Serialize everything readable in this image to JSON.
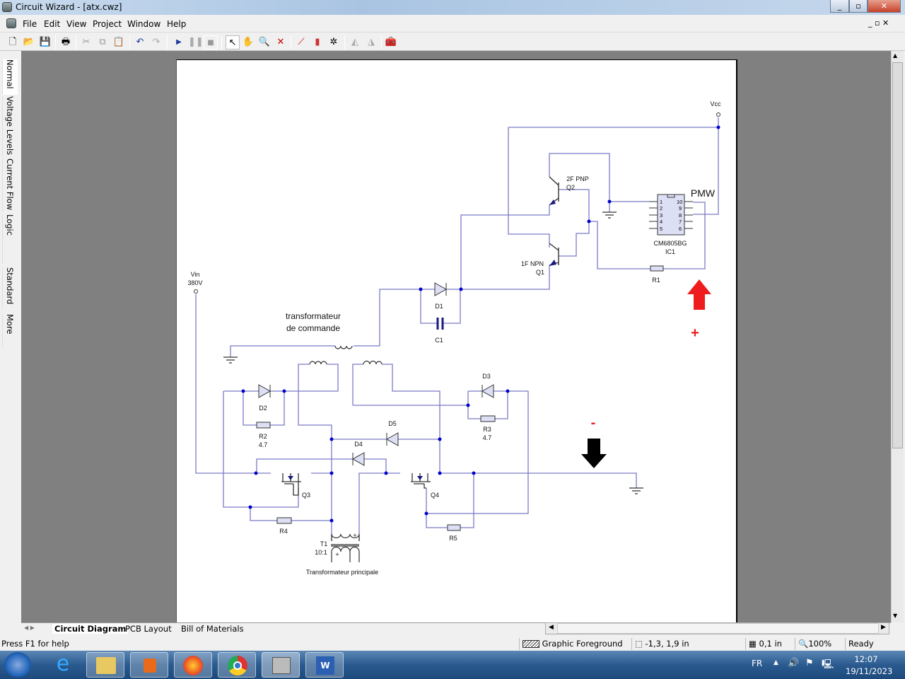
{
  "window": {
    "title": "Circuit Wizard - [atx.cwz]",
    "min": "_",
    "max": "▫",
    "close": "✕"
  },
  "menu": [
    "File",
    "Edit",
    "View",
    "Project",
    "Window",
    "Help"
  ],
  "left_tabs": [
    "Normal",
    "Voltage Levels",
    "Current Flow",
    "Logic Levels",
    "Standard",
    "More ▾"
  ],
  "bottom_tabs": [
    "Circuit Diagram",
    "PCB Layout",
    "Bill of Materials"
  ],
  "status": {
    "help": "Press F1 for help",
    "layer": "Graphic Foreground",
    "coords": "-1,3, 1,9 in",
    "grid": "0,1 in",
    "zoom": "100%",
    "state": "Ready"
  },
  "tray": {
    "lang": "FR",
    "time": "12:07",
    "date": "19/11/2023"
  },
  "circuit": {
    "vin": "Vin",
    "vin_value": "380V",
    "vcc": "Vcc",
    "pmw": "PMW",
    "q2_type": "2F PNP",
    "q2": "Q2",
    "q1_type": "1F NPN",
    "q1": "Q1",
    "ic_part": "CM6805BG",
    "ic": "IC1",
    "ic_pins_left": [
      "1",
      "2",
      "3",
      "4",
      "5"
    ],
    "ic_pins_right": [
      "10",
      "9",
      "8",
      "7",
      "6"
    ],
    "r1": "R1",
    "d1": "D1",
    "c1": "C1",
    "drive_transformer_1": "transformateur",
    "drive_transformer_2": "de commande",
    "d2": "D2",
    "r2": "R2",
    "r2_value": "4.7",
    "d5": "D5",
    "d4": "D4",
    "d3": "D3",
    "r3": "R3",
    "r3_value": "4.7",
    "q3": "Q3",
    "q4": "Q4",
    "r4": "R4",
    "r5": "R5",
    "t1": "T1",
    "t1_ratio": "10:1",
    "t1_plus": "+",
    "main_transformer": "Transformateur principale",
    "plus": "+",
    "minus": "-"
  },
  "colors": {
    "wire": "#7b7bc8",
    "node": "#0000cc",
    "red_arrow": "#ee1c1c",
    "black_arrow": "#000000"
  }
}
